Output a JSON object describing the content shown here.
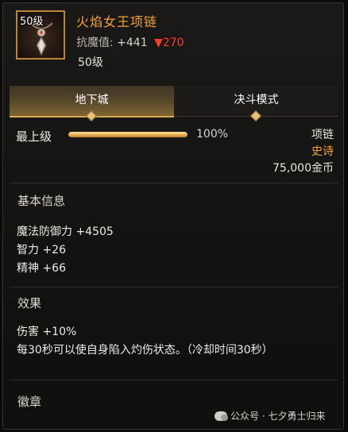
{
  "item": {
    "icon_level": "50级",
    "icon_name": "necklace-icon",
    "name": "火焰女王项链",
    "resist_label": "抗魔值:",
    "resist_value": "+441",
    "resist_drop": "▼270",
    "level_text": "50级"
  },
  "tabs": [
    {
      "label": "地下城",
      "active": true
    },
    {
      "label": "决斗模式",
      "active": false
    }
  ],
  "max_level": {
    "label": "最上级",
    "progress_percent": 100,
    "percent_text": "100%"
  },
  "meta": {
    "slot": "项链",
    "rarity": "史诗",
    "price": "75,000金币"
  },
  "basic_info": {
    "title": "基本信息",
    "lines": [
      "魔法防御力 +4505",
      "智力 +26",
      "精神 +66"
    ]
  },
  "effects": {
    "title": "效果",
    "lines": [
      "伤害 +10%",
      "每30秒可以使自身陷入灼伤状态。（冷却时间30秒）"
    ]
  },
  "emblem": {
    "title": "徽章"
  },
  "watermark": {
    "text": "公众号 · 七夕勇士归来"
  },
  "colors": {
    "accent_orange": "#f3a338",
    "drop_red": "#ff3b30",
    "gold_border": "#b8873b"
  }
}
